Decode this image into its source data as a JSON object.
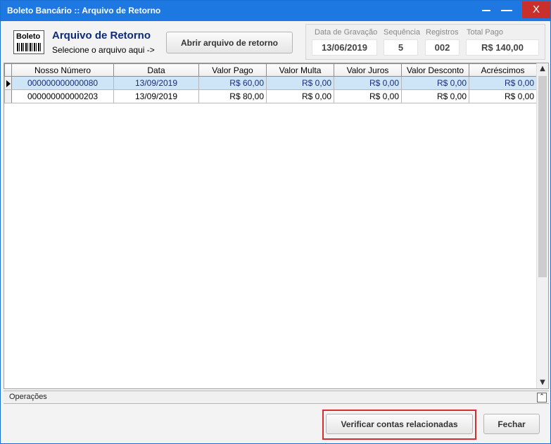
{
  "window": {
    "title": "Boleto Bancário :: Arquivo de Retorno",
    "minimize": "▬",
    "maximize": "▬",
    "close": "X"
  },
  "header": {
    "logo_text": "Boleto",
    "title": "Arquivo de Retorno",
    "subtitle": "Selecione o arquivo aqui ->",
    "open_button": "Abrir arquivo de retorno"
  },
  "info": {
    "data_gravacao_label": "Data de Gravação",
    "data_gravacao_value": "13/06/2019",
    "sequencia_label": "Sequência",
    "sequencia_value": "5",
    "registros_label": "Registros",
    "registros_value": "002",
    "total_pago_label": "Total Pago",
    "total_pago_value": "R$ 140,00"
  },
  "grid": {
    "columns": [
      "Nosso Número",
      "Data",
      "Valor Pago",
      "Valor Multa",
      "Valor Juros",
      "Valor Desconto",
      "Acréscimos"
    ],
    "rows": [
      [
        "000000000000080",
        "13/09/2019",
        "R$ 60,00",
        "R$ 0,00",
        "R$ 0,00",
        "R$ 0,00",
        "R$ 0,00"
      ],
      [
        "000000000000203",
        "13/09/2019",
        "R$ 80,00",
        "R$ 0,00",
        "R$ 0,00",
        "R$ 0,00",
        "R$ 0,00"
      ]
    ]
  },
  "operations": {
    "label": "Operações",
    "collapse_icon": "⌃"
  },
  "footer": {
    "verify_button": "Verificar contas relacionadas",
    "close_button": "Fechar"
  },
  "colors": {
    "titlebar": "#1e78e2",
    "close": "#c9302c",
    "title_text": "#0c2a7a",
    "selected_row": "#cde5f7",
    "highlight": "#d32f2f"
  }
}
